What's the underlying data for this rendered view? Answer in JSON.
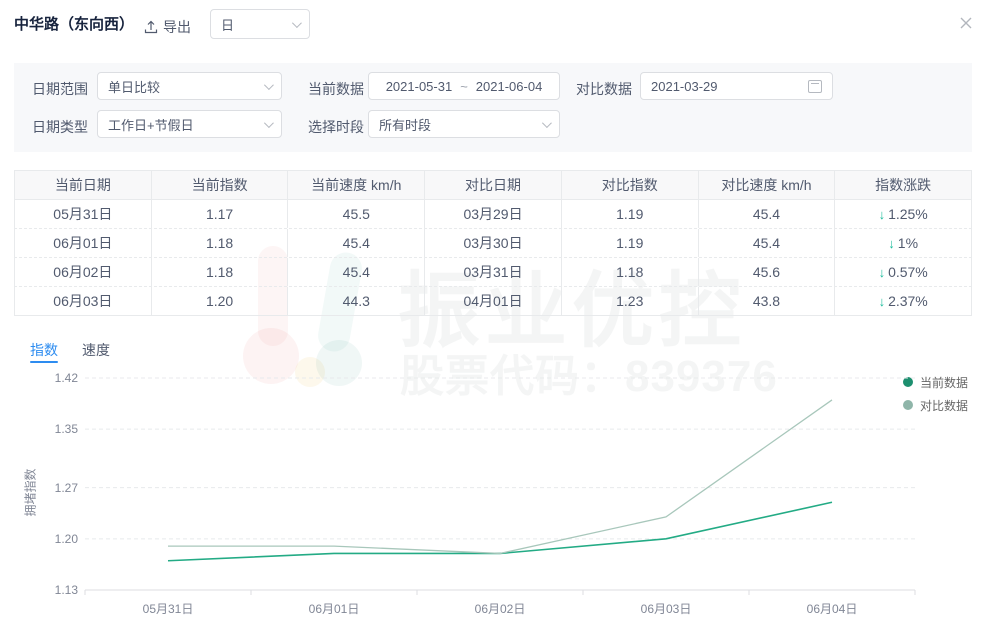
{
  "header": {
    "title": "中华路（东向西）",
    "export_label": "导出",
    "period_value": "日"
  },
  "filters": {
    "date_range_label": "日期范围",
    "date_range_value": "单日比较",
    "current_data_label": "当前数据",
    "current_start": "2021-05-31",
    "range_separator": "~",
    "current_end": "2021-06-04",
    "compare_data_label": "对比数据",
    "compare_value": "2021-03-29",
    "date_type_label": "日期类型",
    "date_type_value": "工作日+节假日",
    "time_label": "选择时段",
    "time_value": "所有时段"
  },
  "table": {
    "headers": [
      "当前日期",
      "当前指数",
      "当前速度 km/h",
      "对比日期",
      "对比指数",
      "对比速度 km/h",
      "指数涨跌"
    ],
    "down_arrow": "↓",
    "rows": [
      {
        "values": [
          "05月31日",
          "1.17",
          "45.5",
          "03月29日",
          "1.19",
          "45.4"
        ],
        "change": "1.25%"
      },
      {
        "values": [
          "06月01日",
          "1.18",
          "45.4",
          "03月30日",
          "1.19",
          "45.4"
        ],
        "change": "1%"
      },
      {
        "values": [
          "06月02日",
          "1.18",
          "45.4",
          "03月31日",
          "1.18",
          "45.6"
        ],
        "change": "0.57%"
      },
      {
        "values": [
          "06月03日",
          "1.20",
          "44.3",
          "04月01日",
          "1.23",
          "43.8"
        ],
        "change": "2.37%"
      }
    ]
  },
  "tabs": [
    {
      "label": "指数",
      "active": true
    },
    {
      "label": "速度",
      "active": false
    }
  ],
  "chart_data": {
    "type": "line",
    "x": [
      "05月31日",
      "06月01日",
      "06月02日",
      "06月03日",
      "06月04日"
    ],
    "series": [
      {
        "name": "当前数据",
        "color": "#23ab85",
        "values": [
          1.17,
          1.18,
          1.18,
          1.2,
          1.25
        ]
      },
      {
        "name": "对比数据",
        "color": "#a8c7bb",
        "values": [
          1.19,
          1.19,
          1.18,
          1.23,
          1.39
        ]
      }
    ],
    "ylabel": "拥堵指数",
    "yticks": [
      1.13,
      1.2,
      1.27,
      1.35,
      1.42
    ],
    "ylim": [
      1.13,
      1.42
    ],
    "legend_position": "top-right",
    "grid": "dashed"
  },
  "watermark": {
    "title": "振业优控",
    "subtitle": "股票代码：839376"
  }
}
